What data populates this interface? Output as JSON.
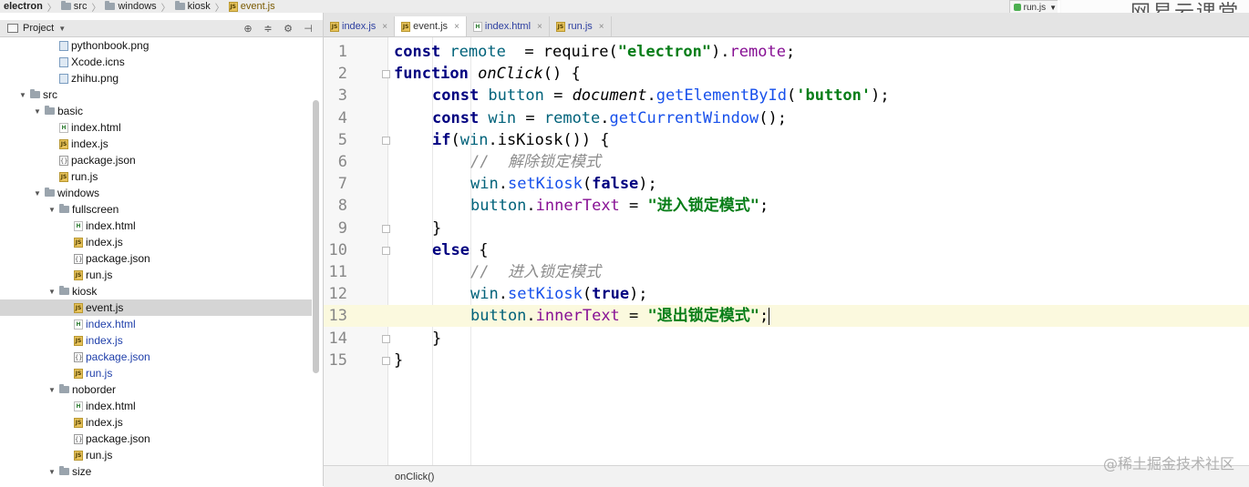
{
  "breadcrumb": [
    "electron",
    "src",
    "windows",
    "kiosk",
    "event.js"
  ],
  "run_config": "run.js",
  "watermark": "网易云课堂",
  "credit": "@稀土掘金技术社区",
  "project": {
    "title": "Project",
    "tools": [
      "crosshair-icon",
      "collapse-icon",
      "gear-icon",
      "hide-icon"
    ]
  },
  "tree": [
    {
      "label": "pythonbook.png",
      "icon": "image-icon",
      "depth": 3,
      "arrow": ""
    },
    {
      "label": "Xcode.icns",
      "icon": "image-icon",
      "depth": 3,
      "arrow": ""
    },
    {
      "label": "zhihu.png",
      "icon": "image-icon",
      "depth": 3,
      "arrow": ""
    },
    {
      "label": "src",
      "icon": "folder-icon",
      "depth": 1,
      "arrow": "▼"
    },
    {
      "label": "basic",
      "icon": "folder-icon",
      "depth": 2,
      "arrow": "▼"
    },
    {
      "label": "index.html",
      "icon": "html-icon",
      "depth": 3,
      "arrow": ""
    },
    {
      "label": "index.js",
      "icon": "js-icon",
      "depth": 3,
      "arrow": ""
    },
    {
      "label": "package.json",
      "icon": "json-icon",
      "depth": 3,
      "arrow": ""
    },
    {
      "label": "run.js",
      "icon": "js-icon",
      "depth": 3,
      "arrow": ""
    },
    {
      "label": "windows",
      "icon": "folder-icon",
      "depth": 2,
      "arrow": "▼"
    },
    {
      "label": "fullscreen",
      "icon": "folder-icon",
      "depth": 3,
      "arrow": "▼"
    },
    {
      "label": "index.html",
      "icon": "html-icon",
      "depth": 4,
      "arrow": ""
    },
    {
      "label": "index.js",
      "icon": "js-icon",
      "depth": 4,
      "arrow": ""
    },
    {
      "label": "package.json",
      "icon": "json-icon",
      "depth": 4,
      "arrow": ""
    },
    {
      "label": "run.js",
      "icon": "js-icon",
      "depth": 4,
      "arrow": ""
    },
    {
      "label": "kiosk",
      "icon": "folder-icon",
      "depth": 3,
      "arrow": "▼"
    },
    {
      "label": "event.js",
      "icon": "js-icon",
      "depth": 4,
      "arrow": "",
      "selected": true
    },
    {
      "label": "index.html",
      "icon": "html-icon",
      "depth": 4,
      "arrow": "",
      "modified": true
    },
    {
      "label": "index.js",
      "icon": "js-icon",
      "depth": 4,
      "arrow": "",
      "modified": true
    },
    {
      "label": "package.json",
      "icon": "json-icon",
      "depth": 4,
      "arrow": "",
      "modified": true
    },
    {
      "label": "run.js",
      "icon": "js-icon",
      "depth": 4,
      "arrow": "",
      "modified": true
    },
    {
      "label": "noborder",
      "icon": "folder-icon",
      "depth": 3,
      "arrow": "▼"
    },
    {
      "label": "index.html",
      "icon": "html-icon",
      "depth": 4,
      "arrow": ""
    },
    {
      "label": "index.js",
      "icon": "js-icon",
      "depth": 4,
      "arrow": ""
    },
    {
      "label": "package.json",
      "icon": "json-icon",
      "depth": 4,
      "arrow": ""
    },
    {
      "label": "run.js",
      "icon": "js-icon",
      "depth": 4,
      "arrow": ""
    },
    {
      "label": "size",
      "icon": "folder-icon",
      "depth": 3,
      "arrow": "▼"
    }
  ],
  "tabs": [
    {
      "label": "index.js",
      "icon": "js-icon",
      "active": false
    },
    {
      "label": "event.js",
      "icon": "js-icon",
      "active": true
    },
    {
      "label": "index.html",
      "icon": "html-icon",
      "active": false
    },
    {
      "label": "run.js",
      "icon": "js-icon",
      "active": false
    }
  ],
  "editor": {
    "current_line": 13,
    "lines": [
      {
        "n": "1",
        "indent": 0,
        "fold": false,
        "tokens": [
          [
            "kw",
            "const "
          ],
          [
            "def",
            "remote"
          ],
          [
            "",
            "  = "
          ],
          [
            "",
            "require"
          ],
          [
            "",
            "("
          ],
          [
            "str",
            "\"electron\""
          ],
          [
            "",
            ")."
          ],
          [
            "prop",
            "remote"
          ],
          [
            "",
            ";"
          ]
        ]
      },
      {
        "n": "2",
        "indent": 0,
        "fold": true,
        "tokens": [
          [
            "kw",
            "function "
          ],
          [
            "fn-it",
            "onClick"
          ],
          [
            "",
            "() {"
          ]
        ]
      },
      {
        "n": "3",
        "indent": 1,
        "fold": false,
        "tokens": [
          [
            "kw",
            "const "
          ],
          [
            "def",
            "button"
          ],
          [
            "",
            " = "
          ],
          [
            "fn-it",
            "document"
          ],
          [
            "",
            "."
          ],
          [
            "meth",
            "getElementById"
          ],
          [
            "",
            "("
          ],
          [
            "str",
            "'button'"
          ],
          [
            "",
            ");"
          ]
        ]
      },
      {
        "n": "4",
        "indent": 1,
        "fold": false,
        "tokens": [
          [
            "kw",
            "const "
          ],
          [
            "def",
            "win"
          ],
          [
            "",
            " = "
          ],
          [
            "def",
            "remote"
          ],
          [
            "",
            "."
          ],
          [
            "meth",
            "getCurrentWindow"
          ],
          [
            "",
            "();"
          ]
        ]
      },
      {
        "n": "5",
        "indent": 1,
        "fold": true,
        "tokens": [
          [
            "kw",
            "if"
          ],
          [
            "",
            "("
          ],
          [
            "def",
            "win"
          ],
          [
            "",
            "."
          ],
          [
            "",
            "isKiosk"
          ],
          [
            "",
            "()) {"
          ]
        ]
      },
      {
        "n": "6",
        "indent": 2,
        "fold": false,
        "tokens": [
          [
            "cmt",
            "//  解除锁定模式"
          ]
        ]
      },
      {
        "n": "7",
        "indent": 2,
        "fold": false,
        "tokens": [
          [
            "def",
            "win"
          ],
          [
            "",
            "."
          ],
          [
            "meth",
            "setKiosk"
          ],
          [
            "",
            "("
          ],
          [
            "kw",
            "false"
          ],
          [
            "",
            ");"
          ]
        ]
      },
      {
        "n": "8",
        "indent": 2,
        "fold": false,
        "tokens": [
          [
            "def",
            "button"
          ],
          [
            "",
            "."
          ],
          [
            "prop",
            "innerText"
          ],
          [
            "",
            " = "
          ],
          [
            "str",
            "\"进入锁定模式\""
          ],
          [
            "",
            ";"
          ]
        ]
      },
      {
        "n": "9",
        "indent": 1,
        "fold": true,
        "tokens": [
          [
            "",
            "}"
          ]
        ]
      },
      {
        "n": "10",
        "indent": 1,
        "fold": true,
        "tokens": [
          [
            "kw",
            "else "
          ],
          [
            "",
            "{"
          ]
        ]
      },
      {
        "n": "11",
        "indent": 2,
        "fold": false,
        "tokens": [
          [
            "cmt",
            "//  进入锁定模式"
          ]
        ]
      },
      {
        "n": "12",
        "indent": 2,
        "fold": false,
        "tokens": [
          [
            "def",
            "win"
          ],
          [
            "",
            "."
          ],
          [
            "meth",
            "setKiosk"
          ],
          [
            "",
            "("
          ],
          [
            "kw",
            "true"
          ],
          [
            "",
            ");"
          ]
        ]
      },
      {
        "n": "13",
        "indent": 2,
        "fold": false,
        "tokens": [
          [
            "def",
            "button"
          ],
          [
            "",
            "."
          ],
          [
            "prop",
            "innerText"
          ],
          [
            "",
            " = "
          ],
          [
            "str",
            "\"退出锁定模式\""
          ],
          [
            "",
            ";"
          ]
        ]
      },
      {
        "n": "14",
        "indent": 1,
        "fold": true,
        "tokens": [
          [
            "",
            "}"
          ]
        ]
      },
      {
        "n": "15",
        "indent": 0,
        "fold": true,
        "tokens": [
          [
            "",
            "}"
          ]
        ]
      }
    ]
  },
  "status": {
    "breadcrumb": "onClick()"
  }
}
